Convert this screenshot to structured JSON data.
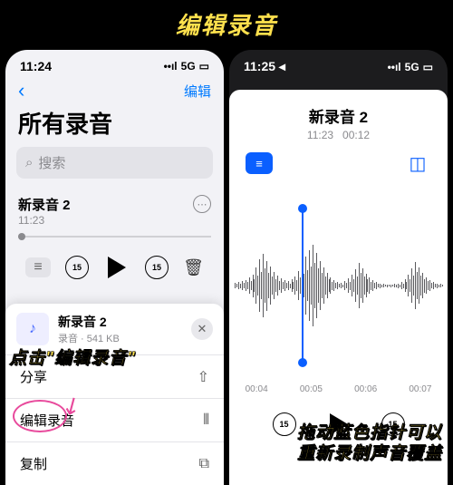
{
  "page_title": "编辑录音",
  "callouts": {
    "left": "点击\"编辑录音\"",
    "right_l1": "拖动蓝色指针可以",
    "right_l2": "重新录制声音覆盖"
  },
  "left": {
    "status": {
      "time": "11:24",
      "signal": "􀙇",
      "net": "5G",
      "batt": "􀛨"
    },
    "nav": {
      "back": "‹",
      "edit": "编辑"
    },
    "header": "所有录音",
    "search": {
      "icon": "􀊫",
      "placeholder": "搜索"
    },
    "recording": {
      "title": "新录音 2",
      "time": "11:23"
    },
    "skip_label": "15",
    "sheet": {
      "file_title": "新录音 2",
      "file_sub": "录音 · 541 KB",
      "rows": [
        {
          "label": "分享",
          "icon": "􀈂"
        },
        {
          "label": "编辑录音",
          "icon": "􀜟"
        },
        {
          "label": "复制",
          "icon": "􀉁"
        }
      ]
    }
  },
  "right": {
    "status": {
      "time": "11:25 ◂",
      "net": "5G"
    },
    "title": "新录音 2",
    "sub_time": "11:23",
    "sub_dur": "00:12",
    "ticks": [
      "00:04",
      "00:05",
      "00:06",
      "00:07"
    ],
    "skip_label": "15"
  }
}
